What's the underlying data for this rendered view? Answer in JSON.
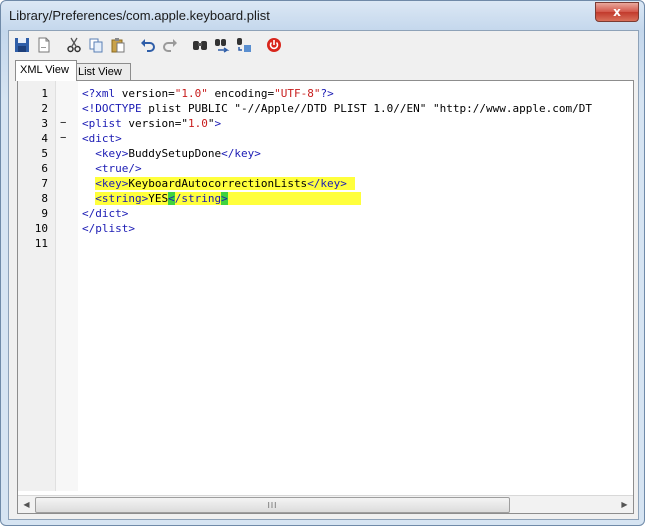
{
  "window": {
    "title": "Library/Preferences/com.apple.keyboard.plist",
    "close_label": "x"
  },
  "toolbar": [
    {
      "name": "save-icon"
    },
    {
      "name": "new-document-icon"
    },
    {
      "name": "cut-icon"
    },
    {
      "name": "copy-icon"
    },
    {
      "name": "paste-icon"
    },
    {
      "name": "undo-icon"
    },
    {
      "name": "redo-icon"
    },
    {
      "name": "find-icon"
    },
    {
      "name": "find-next-icon"
    },
    {
      "name": "replace-icon"
    },
    {
      "name": "power-icon"
    }
  ],
  "tabs": {
    "xml_view": "XML View",
    "list_view": "List View",
    "active": "xml_view"
  },
  "editor": {
    "line_numbers": [
      "1",
      "2",
      "3",
      "4",
      "5",
      "6",
      "7",
      "8",
      "9",
      "10",
      "11"
    ],
    "fold_markers": [
      "",
      "",
      "−",
      "−",
      "",
      "",
      "",
      "",
      "",
      "",
      ""
    ],
    "lines": [
      "<?xml version=\"1.0\" encoding=\"UTF-8\"?>",
      "<!DOCTYPE plist PUBLIC \"-//Apple//DTD PLIST 1.0//EN\" \"http://www.apple.com/DT",
      "<plist version=\"1.0\">",
      "<dict>",
      "  <key>BuddySetupDone</key>",
      "  <true/>",
      "  <key>KeyboardAutocorrectionLists</key>",
      "  <string>YES</string>",
      "</dict>",
      "</plist>",
      ""
    ],
    "highlight_color": "#ffff3c",
    "match_color": "#3fd23f"
  },
  "scrollbar": {
    "grip": "III"
  }
}
